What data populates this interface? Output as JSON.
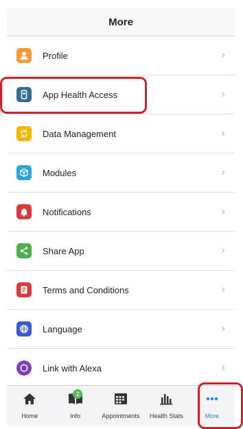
{
  "header": {
    "title": "More"
  },
  "menu": [
    {
      "label": "Profile",
      "icon": "person-icon",
      "color": "#f39a3b"
    },
    {
      "label": "App Health Access",
      "icon": "phone-icon",
      "color": "#2f6f8f"
    },
    {
      "label": "Data Management",
      "icon": "sync-icon",
      "color": "#f5b800"
    },
    {
      "label": "Modules",
      "icon": "cube-icon",
      "color": "#2ea3e6"
    },
    {
      "label": "Notifications",
      "icon": "bell-icon",
      "color": "#d93a3a"
    },
    {
      "label": "Share App",
      "icon": "share-icon",
      "color": "#4caf50"
    },
    {
      "label": "Terms and Conditions",
      "icon": "document-icon",
      "color": "#d93a3a"
    },
    {
      "label": "Language",
      "icon": "globe-icon",
      "color": "#3b5bcc"
    },
    {
      "label": "Link with Alexa",
      "icon": "alexa-icon",
      "color": "#7b3fb5"
    }
  ],
  "tabs": [
    {
      "label": "Home",
      "icon": "home-icon"
    },
    {
      "label": "Info",
      "icon": "book-icon",
      "badge": "2"
    },
    {
      "label": "Appointments",
      "icon": "calendar-icon"
    },
    {
      "label": "Health Stats",
      "icon": "bar-chart-icon"
    },
    {
      "label": "More",
      "icon": "more-dots-icon",
      "active": true
    }
  ],
  "colors": {
    "highlight": "#d0202b",
    "active_tab": "#1e88e5"
  }
}
